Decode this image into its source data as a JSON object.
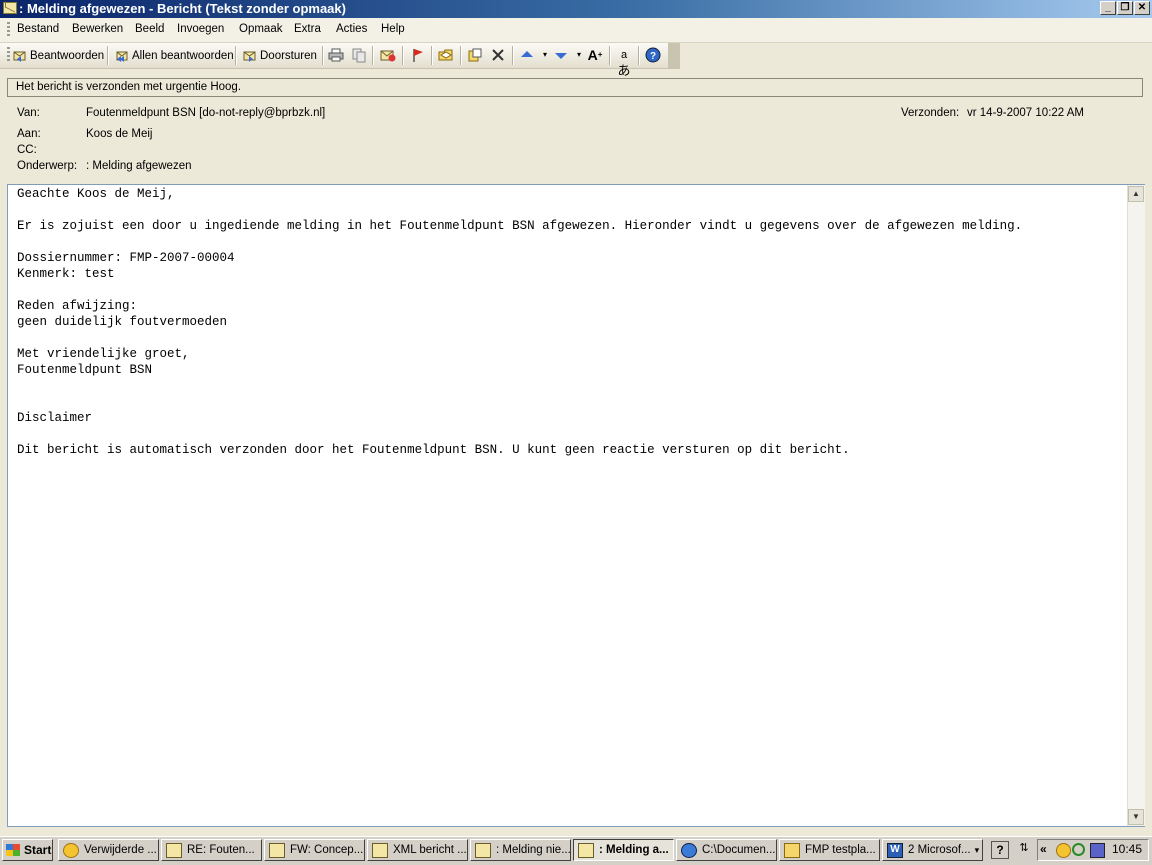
{
  "window": {
    "title": ": Melding afgewezen - Bericht (Tekst zonder opmaak)",
    "controls": [
      "_",
      "❐",
      "✕"
    ]
  },
  "menu": [
    "Bestand",
    "Bewerken",
    "Beeld",
    "Invoegen",
    "Opmaak",
    "Extra",
    "Acties",
    "Help"
  ],
  "toolbar": {
    "reply": "Beantwoorden",
    "reply_all": "Allen beantwoorden",
    "forward": "Doorsturen",
    "icons": [
      "print-icon",
      "copy-icon",
      "mark-unread-icon",
      "flag-icon",
      "open-folder-icon",
      "move-icon",
      "delete-icon",
      "previous-item-icon",
      "next-item-icon",
      "font-size-icon",
      "translate-icon",
      "help-icon"
    ]
  },
  "infobar": {
    "text": "Het bericht is verzonden met urgentie Hoog."
  },
  "header": {
    "from_label": "Van:",
    "from_value": "Foutenmeldpunt BSN [do-not-reply@bprbzk.nl]",
    "sent_label": "Verzonden:",
    "sent_value": "vr 14-9-2007 10:22 AM",
    "to_label": "Aan:",
    "to_value": "Koos de Meij",
    "cc_label": "CC:",
    "cc_value": "",
    "subject_label": "Onderwerp:",
    "subject_value": ": Melding afgewezen"
  },
  "body": {
    "text": "Geachte Koos de Meij,\n\nEr is zojuist een door u ingediende melding in het Foutenmeldpunt BSN afgewezen. Hieronder vindt u gegevens over de afgewezen melding.\n\nDossiernummer: FMP-2007-00004\nKenmerk: test\n\nReden afwijzing:\ngeen duidelijk foutvermoeden\n\nMet vriendelijke groet,\nFoutenmeldpunt BSN\n\n\nDisclaimer\n\nDit bericht is automatisch verzonden door het Foutenmeldpunt BSN. U kunt geen reactie versturen op dit bericht."
  },
  "taskbar": {
    "start": "Start",
    "tasks": [
      "Verwijderde ...",
      "RE: Fouten...",
      "FW: Concep...",
      "XML bericht ...",
      ": Melding nie...",
      ": Melding a...",
      "C:\\Documen...",
      "FMP testpla...",
      "2 Microsof..."
    ],
    "clock": "10:45"
  },
  "colors": {
    "title_gradient_start": "#0a246a",
    "title_gradient_end": "#a6caf0",
    "chrome": "#ece9d8",
    "body_background": "#ffffff"
  }
}
